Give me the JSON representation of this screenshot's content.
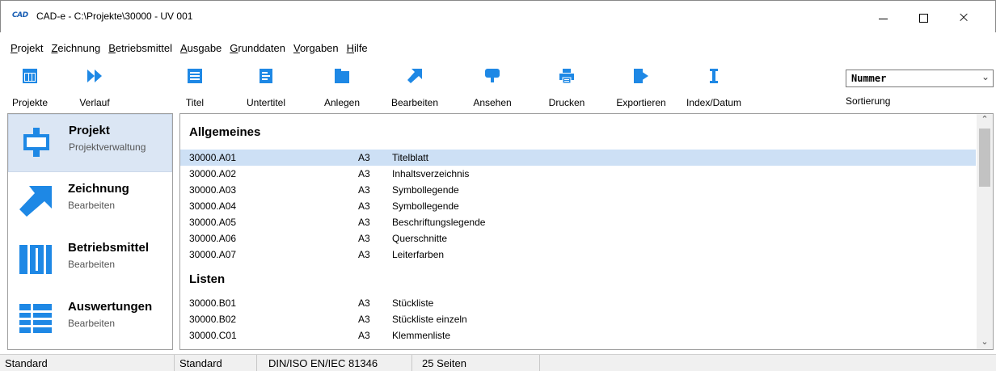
{
  "window": {
    "logo": "CAD",
    "title": "CAD-e - C:\\Projekte\\30000 - UV 001",
    "controls": {
      "minimize": "minimize",
      "maximize": "maximize",
      "close": "×"
    }
  },
  "menu": [
    "Projekt",
    "Zeichnung",
    "Betriebsmittel",
    "Ausgabe",
    "Grunddaten",
    "Vorgaben",
    "Hilfe"
  ],
  "toolbar": {
    "buttons": [
      {
        "label": "Projekte",
        "icon": "projects-icon"
      },
      {
        "label": "Verlauf",
        "icon": "history-icon"
      },
      {
        "label": "Titel",
        "icon": "title-icon"
      },
      {
        "label": "Untertitel",
        "icon": "subtitle-icon"
      },
      {
        "label": "Anlegen",
        "icon": "create-icon"
      },
      {
        "label": "Bearbeiten",
        "icon": "edit-icon"
      },
      {
        "label": "Ansehen",
        "icon": "view-icon"
      },
      {
        "label": "Drucken",
        "icon": "print-icon"
      },
      {
        "label": "Exportieren",
        "icon": "export-icon"
      },
      {
        "label": "Index/Datum",
        "icon": "index-icon"
      }
    ],
    "sort": {
      "value": "Nummer",
      "caption": "Sortierung"
    }
  },
  "nav": [
    {
      "title": "Projekt",
      "subtitle": "Projektverwaltung",
      "active": true
    },
    {
      "title": "Zeichnung",
      "subtitle": "Bearbeiten",
      "active": false
    },
    {
      "title": "Betriebsmittel",
      "subtitle": "Bearbeiten",
      "active": false
    },
    {
      "title": "Auswertungen",
      "subtitle": "Bearbeiten",
      "active": false
    }
  ],
  "groups": [
    {
      "title": "Allgemeines",
      "rows": [
        {
          "number": "30000.A01",
          "format": "A3",
          "title": "Titelblatt",
          "selected": true
        },
        {
          "number": "30000.A02",
          "format": "A3",
          "title": "Inhaltsverzeichnis"
        },
        {
          "number": "30000.A03",
          "format": "A3",
          "title": "Symbollegende"
        },
        {
          "number": "30000.A04",
          "format": "A3",
          "title": "Symbollegende"
        },
        {
          "number": "30000.A05",
          "format": "A3",
          "title": "Beschriftungslegende"
        },
        {
          "number": "30000.A06",
          "format": "A3",
          "title": "Querschnitte"
        },
        {
          "number": "30000.A07",
          "format": "A3",
          "title": "Leiterfarben"
        }
      ]
    },
    {
      "title": "Listen",
      "rows": [
        {
          "number": "30000.B01",
          "format": "A3",
          "title": "Stückliste"
        },
        {
          "number": "30000.B02",
          "format": "A3",
          "title": "Stückliste einzeln"
        },
        {
          "number": "30000.C01",
          "format": "A3",
          "title": "Klemmenliste"
        }
      ]
    }
  ],
  "status": [
    "Standard",
    "Standard",
    "DIN/ISO EN/IEC 81346",
    "25 Seiten"
  ],
  "colors": {
    "accent": "#1e88e5",
    "selection": "#cde0f5",
    "nav_active": "#dbe6f4"
  }
}
